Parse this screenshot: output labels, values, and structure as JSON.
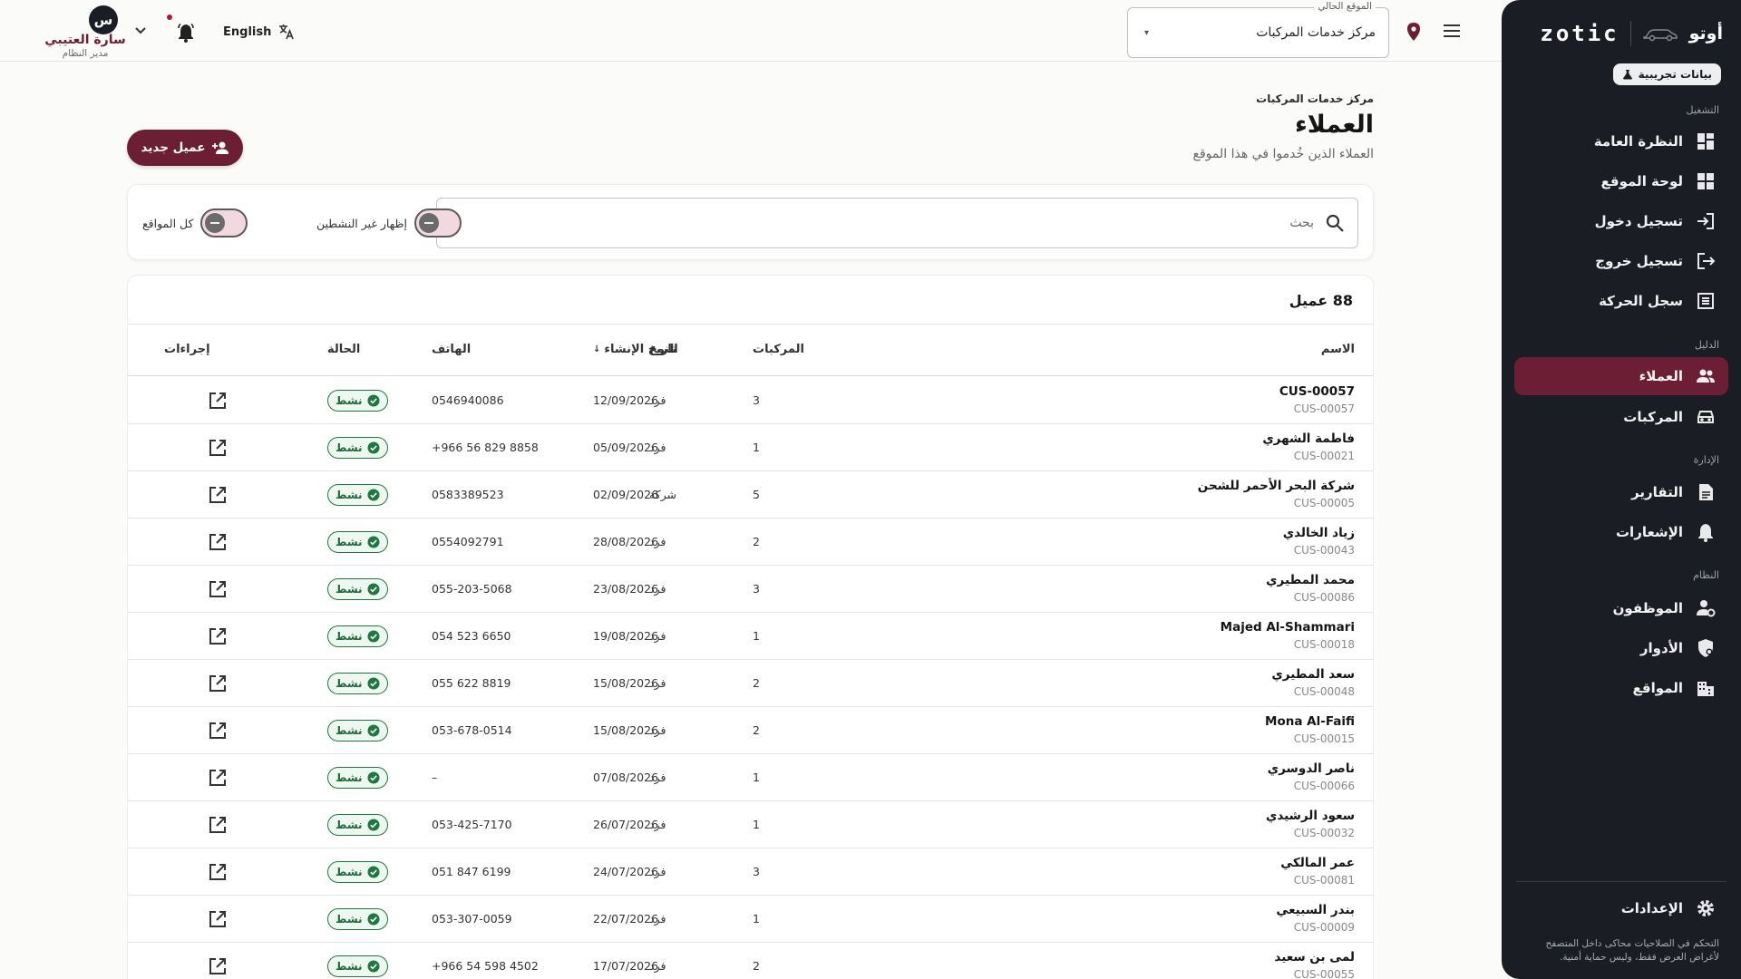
{
  "sidebar": {
    "brand_name": "أوتو",
    "brand_logo": "zotic",
    "demo_badge": "بيانات تجريبية",
    "sections": {
      "operation": "التشغيل",
      "directory": "الدليل",
      "management": "الإدارة",
      "system": "النظام"
    },
    "items": [
      {
        "label": "النظرة العامة",
        "icon": "dashboard-icon"
      },
      {
        "label": "لوحة الموقع",
        "icon": "grid-icon"
      },
      {
        "label": "تسجيل دخول",
        "icon": "login-icon"
      },
      {
        "label": "تسجيل خروج",
        "icon": "logout-icon"
      },
      {
        "label": "سجل الحركة",
        "icon": "list-icon"
      },
      {
        "label": "العملاء",
        "icon": "people-icon"
      },
      {
        "label": "المركبات",
        "icon": "car-icon"
      },
      {
        "label": "التقارير",
        "icon": "report-icon"
      },
      {
        "label": "الإشعارات",
        "icon": "bell-icon"
      },
      {
        "label": "الموظفون",
        "icon": "staff-icon"
      },
      {
        "label": "الأدوار",
        "icon": "shield-icon"
      },
      {
        "label": "المواقع",
        "icon": "building-icon"
      }
    ],
    "settings_label": "الإعدادات",
    "note": "التحكم في الصلاحيات محاكى داخل المتصفح لأغراض العرض فقط، وليس حماية أمنية."
  },
  "topbar": {
    "location_legend": "الموقع الحالي",
    "location_value": "مركز خدمات المركبات",
    "language": "English",
    "user_initial": "س",
    "user_name": "سارة العتيبي",
    "user_role": "مدير النظام",
    "notification_dot_color": "#b3123a"
  },
  "page": {
    "breadcrumb": "مركز خدمات المركبات",
    "title": "العملاء",
    "subtitle": "العملاء الذين خُدموا في هذا الموقع",
    "new_button": "عميل جديد"
  },
  "filters": {
    "search_placeholder": "بحث",
    "show_inactive": "إظهار غير النشطين",
    "all_locations": "كل المواقع"
  },
  "table": {
    "count": "88 عميل",
    "columns": {
      "name": "الاسم",
      "phone": "الهاتف",
      "type": "النوع",
      "vehicles": "المركبات",
      "created": "تاريخ الإنشاء",
      "status": "الحالة",
      "actions": "إجراءات"
    },
    "rows": [
      {
        "name": "CUS-00057",
        "code": "CUS-00057",
        "phone": "0546940086",
        "type": "فرد",
        "vehicles": "3",
        "date": "12/09/2026",
        "status": "نشط"
      },
      {
        "name": "فاطمة الشهري",
        "code": "CUS-00021",
        "phone": "+966 56 829 8858",
        "type": "فرد",
        "vehicles": "1",
        "date": "05/09/2026",
        "status": "نشط"
      },
      {
        "name": "شركة البحر الأحمر للشحن",
        "code": "CUS-00005",
        "phone": "0583389523",
        "type": "شركة",
        "vehicles": "5",
        "date": "02/09/2026",
        "status": "نشط"
      },
      {
        "name": "زياد الخالدي",
        "code": "CUS-00043",
        "phone": "0554092791",
        "type": "فرد",
        "vehicles": "2",
        "date": "28/08/2026",
        "status": "نشط"
      },
      {
        "name": "محمد المطيري",
        "code": "CUS-00086",
        "phone": "055-203-5068",
        "type": "فرد",
        "vehicles": "3",
        "date": "23/08/2026",
        "status": "نشط"
      },
      {
        "name": "Majed Al-Shammari",
        "code": "CUS-00018",
        "phone": "054 523 6650",
        "type": "فرد",
        "vehicles": "1",
        "date": "19/08/2026",
        "status": "نشط"
      },
      {
        "name": "سعد المطيري",
        "code": "CUS-00048",
        "phone": "055 622 8819",
        "type": "فرد",
        "vehicles": "2",
        "date": "15/08/2026",
        "status": "نشط"
      },
      {
        "name": "Mona Al-Faifi",
        "code": "CUS-00015",
        "phone": "053-678-0514",
        "type": "فرد",
        "vehicles": "2",
        "date": "15/08/2026",
        "status": "نشط"
      },
      {
        "name": "ناصر الدوسري",
        "code": "CUS-00066",
        "phone": "–",
        "type": "فرد",
        "vehicles": "1",
        "date": "07/08/2026",
        "status": "نشط"
      },
      {
        "name": "سعود الرشيدي",
        "code": "CUS-00032",
        "phone": "053-425-7170",
        "type": "فرد",
        "vehicles": "1",
        "date": "26/07/2026",
        "status": "نشط"
      },
      {
        "name": "عمر المالكي",
        "code": "CUS-00081",
        "phone": "051 847 6199",
        "type": "فرد",
        "vehicles": "3",
        "date": "24/07/2026",
        "status": "نشط"
      },
      {
        "name": "بندر السبيعي",
        "code": "CUS-00009",
        "phone": "053-307-0059",
        "type": "فرد",
        "vehicles": "1",
        "date": "22/07/2026",
        "status": "نشط"
      },
      {
        "name": "لمى بن سعيد",
        "code": "CUS-00055",
        "phone": "+966 54 598 4502",
        "type": "فرد",
        "vehicles": "2",
        "date": "17/07/2026",
        "status": "نشط"
      }
    ]
  },
  "colors": {
    "accent": "#6c1f34",
    "sidebar_bg": "#1a1d24",
    "status_active": "#1d7a3e"
  }
}
